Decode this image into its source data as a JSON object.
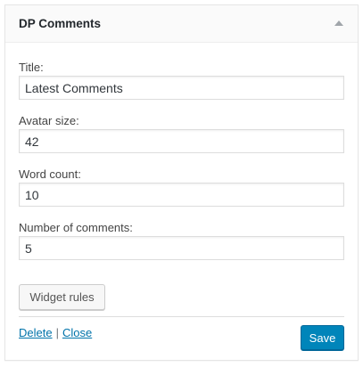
{
  "widget": {
    "title": "DP Comments",
    "toggle_icon": "triangle-up-icon"
  },
  "fields": [
    {
      "label": "Title:",
      "value": "Latest Comments"
    },
    {
      "label": "Avatar size:",
      "value": "42"
    },
    {
      "label": "Word count:",
      "value": "10"
    },
    {
      "label": "Number of comments:",
      "value": "5"
    }
  ],
  "buttons": {
    "widget_rules": "Widget rules",
    "save": "Save"
  },
  "links": {
    "delete": "Delete",
    "separator": "|",
    "close": "Close"
  },
  "colors": {
    "link": "#0073aa",
    "primary_button": "#0085ba"
  }
}
